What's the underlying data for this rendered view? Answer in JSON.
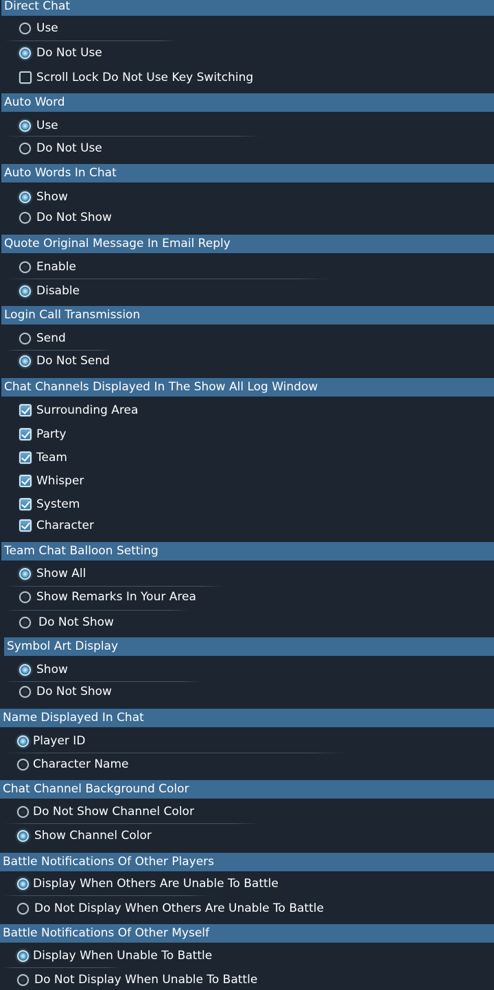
{
  "sections": {
    "direct_chat": {
      "title": "Direct Chat",
      "options": [
        "Use",
        "Do Not Use"
      ],
      "selected": "Do Not Use",
      "checkbox_label": "Scroll Lock Do Not Use Key Switching",
      "checkbox_checked": false
    },
    "auto_word": {
      "title": "Auto Word",
      "options": [
        "Use",
        "Do Not Use"
      ],
      "selected": "Use"
    },
    "auto_words_in_chat": {
      "title": "Auto Words In Chat",
      "options": [
        "Show",
        "Do Not Show"
      ],
      "selected": "Show"
    },
    "quote_original": {
      "title": "Quote Original Message In Email Reply",
      "options": [
        "Enable",
        "Disable"
      ],
      "selected": "Disable"
    },
    "login_call": {
      "title": "Login Call Transmission",
      "options": [
        "Send",
        "Do Not Send"
      ],
      "selected": "Do Not Send"
    },
    "chat_channels": {
      "title": "Chat Channels Displayed In The Show All Log Window",
      "checkboxes": [
        "Surrounding Area",
        "Party",
        "Team",
        "Whisper",
        "System",
        "Character"
      ],
      "checked": [
        true,
        true,
        true,
        true,
        true,
        true
      ]
    },
    "team_chat_balloon": {
      "title": "Team Chat Balloon Setting",
      "options": [
        "Show All",
        "Show Remarks In Your Area",
        "Do Not Show"
      ],
      "selected": "Show All"
    },
    "symbol_art": {
      "title": "Symbol Art Display",
      "options": [
        "Show",
        "Do Not Show"
      ],
      "selected": "Show"
    },
    "name_displayed": {
      "title": "Name Displayed In Chat",
      "options": [
        "Player ID",
        "Character Name"
      ],
      "selected": "Player ID"
    },
    "channel_bg": {
      "title": "Chat Channel Background Color",
      "options": [
        "Do Not Show Channel Color",
        "Show Channel Color"
      ],
      "selected": "Show Channel Color"
    },
    "battle_others": {
      "title": "Battle Notifications Of Other Players",
      "options": [
        "Display When Others Are Unable To Battle",
        "Do Not Display When Others Are Unable To Battle"
      ],
      "selected": "Display When Others Are Unable To Battle"
    },
    "battle_myself": {
      "title": "Battle Notifications Of Other Myself",
      "options": [
        "Display When Unable To Battle",
        "Do Not Display When Unable To Battle"
      ],
      "selected": "Display When Unable To Battle"
    }
  },
  "colors": {
    "background": "#1c2530",
    "header": "#3c6b94",
    "radio_selected": "#8cc6e8"
  }
}
